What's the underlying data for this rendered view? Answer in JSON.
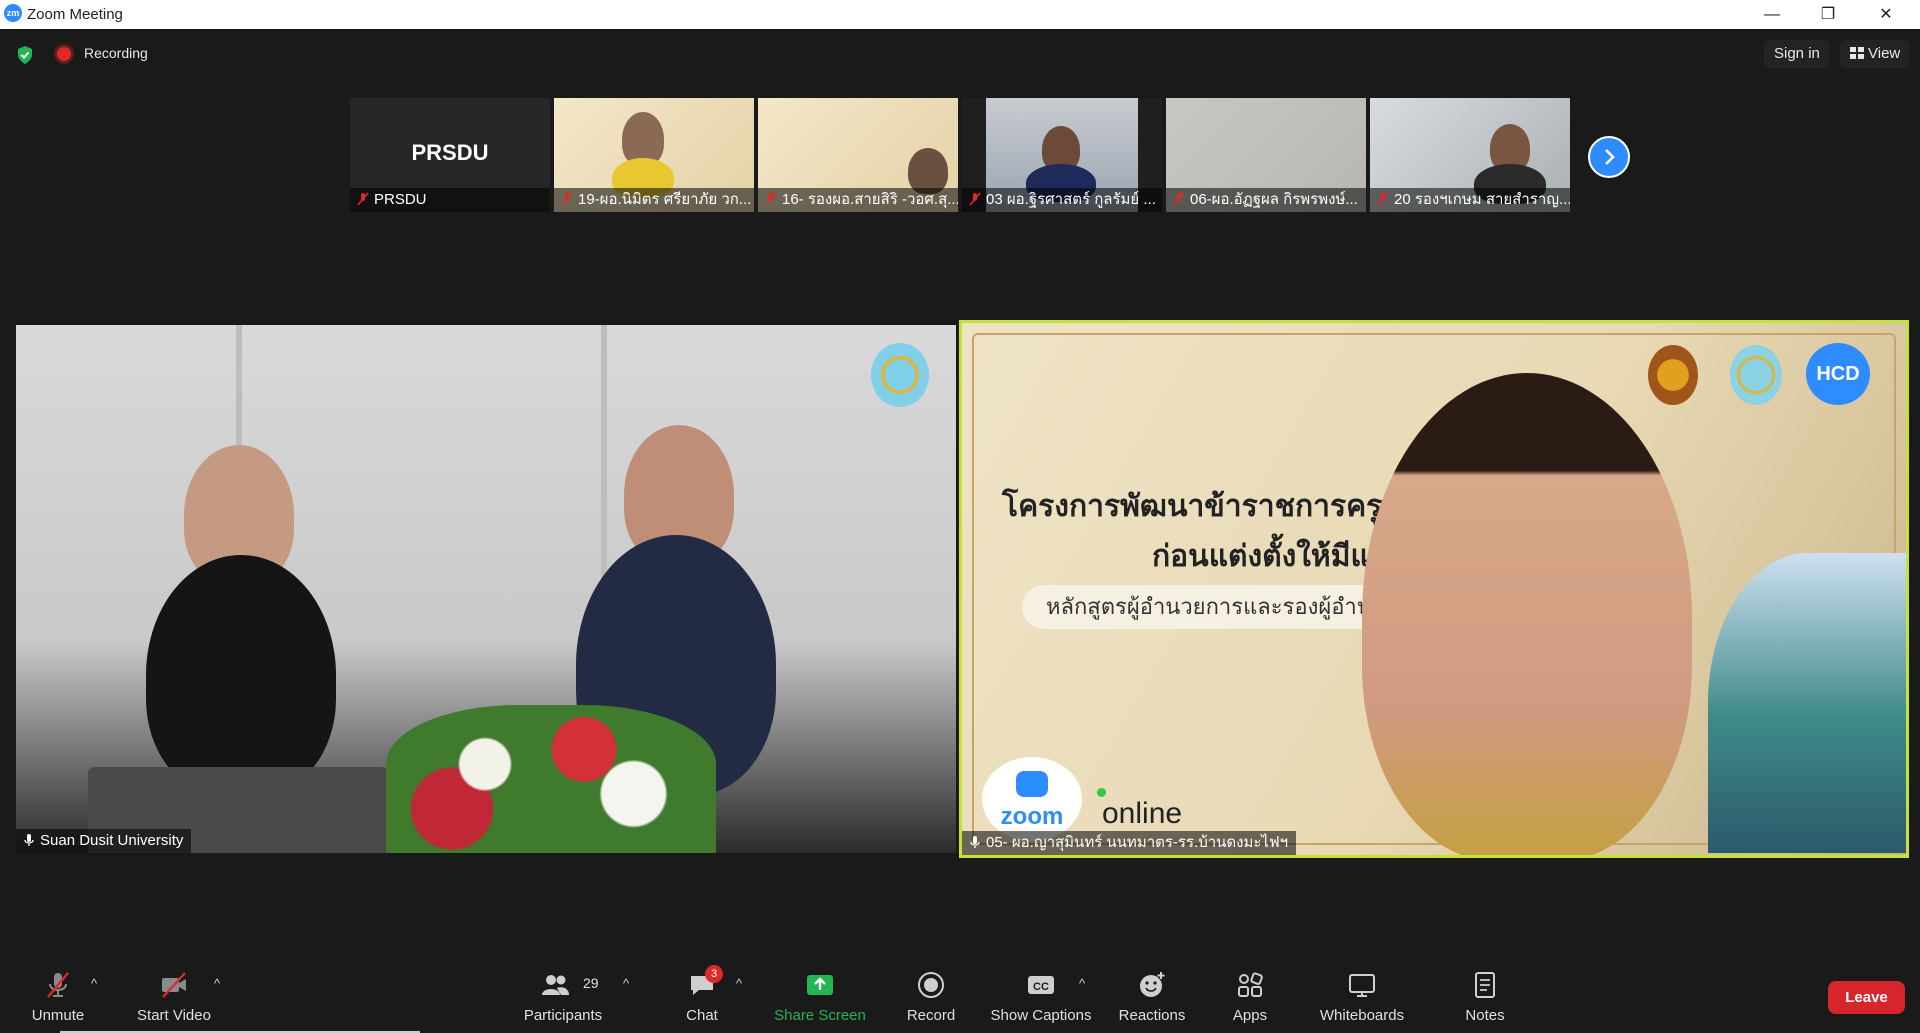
{
  "window": {
    "title": "Zoom Meeting",
    "logo_text": "zm",
    "controls": [
      "—",
      "❐",
      "✕"
    ]
  },
  "topbar": {
    "recording_label": "Recording",
    "sign_in": "Sign in",
    "view": "View"
  },
  "thumbnails": [
    {
      "name": "PRSDU",
      "big_name": "PRSDU"
    },
    {
      "name": "19-ผอ.นิมิตร ศรียาภัย  วก..."
    },
    {
      "name": "16- รองผอ.สายสิริ -วอศ.สุ..."
    },
    {
      "name": "03 ผอ.ฐิรศาสตร์ กูลรัมย์  ..."
    },
    {
      "name": "06-ผอ.อัฏฐผล กิรพรพงษ์..."
    },
    {
      "name": "20 รองฯเกษม สายสำราญ..."
    }
  ],
  "main_videos": {
    "left": {
      "name": "Suan Dusit University"
    },
    "right": {
      "name": "05- ผอ.ญาสุมินทร์ นนทมาตร-รร.บ้านดงมะไฟฯ",
      "slide_title": "โครงการพัฒนาข้าราชการครูและ",
      "slide_sub": "ก่อนแต่งตั้งให้มีและเลื่อ",
      "slide_pill": "หลักสูตรผู้อำนวยการและรองผู้อำนวยก",
      "badge_text": "HCD",
      "zoom_text": "zoom",
      "online_text": "online"
    }
  },
  "toolbar": {
    "unmute": "Unmute",
    "start_video": "Start Video",
    "participants": "Participants",
    "participants_count": "29",
    "chat": "Chat",
    "chat_badge": "3",
    "share_screen": "Share Screen",
    "record": "Record",
    "show_captions": "Show Captions",
    "captions_icon": "CC",
    "reactions": "Reactions",
    "apps": "Apps",
    "whiteboards": "Whiteboards",
    "notes": "Notes",
    "leave": "Leave"
  },
  "colors": {
    "accent": "#2d8cff",
    "leave": "#d7262b",
    "speaker_border": "#c5e334",
    "share_green": "#23b553",
    "muted_red": "#e02828"
  }
}
